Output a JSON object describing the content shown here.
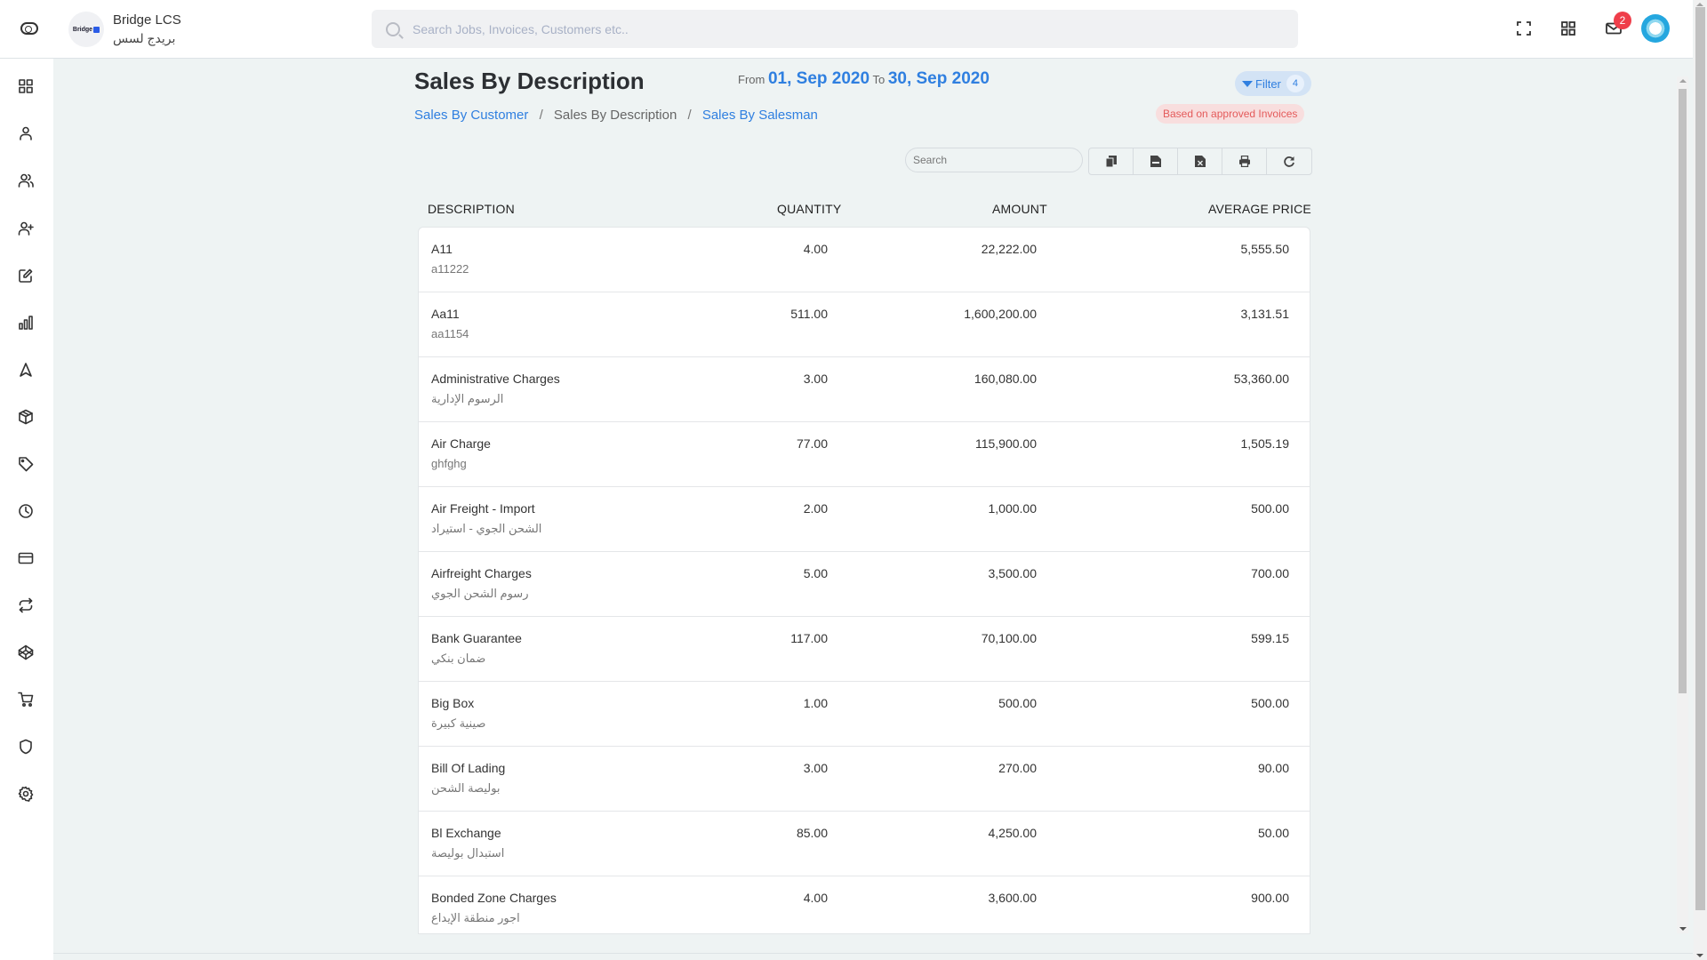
{
  "app": {
    "brand_name": "Bridge LCS",
    "brand_name_ar": "بريدج لسس",
    "logo_text": "Bridge"
  },
  "header": {
    "search_placeholder": "Search Jobs, Invoices, Customers etc..",
    "notification_count": "2",
    "icons": [
      "sidebar-toggle-icon",
      "fullscreen-icon",
      "apps-grid-icon",
      "mail-icon",
      "user-avatar"
    ]
  },
  "sidebar": {
    "items": [
      {
        "name": "dashboard",
        "icon": "grid-icon"
      },
      {
        "name": "user",
        "icon": "user-icon"
      },
      {
        "name": "users",
        "icon": "users-icon"
      },
      {
        "name": "add-user",
        "icon": "user-plus-icon"
      },
      {
        "name": "edit",
        "icon": "edit-icon"
      },
      {
        "name": "reports",
        "icon": "bar-chart-icon"
      },
      {
        "name": "navigation",
        "icon": "navigation-icon"
      },
      {
        "name": "packages",
        "icon": "box-icon"
      },
      {
        "name": "tags",
        "icon": "tag-icon"
      },
      {
        "name": "history",
        "icon": "clock-icon"
      },
      {
        "name": "payments",
        "icon": "credit-card-icon"
      },
      {
        "name": "transfers",
        "icon": "repeat-icon"
      },
      {
        "name": "codepen",
        "icon": "codepen-icon"
      },
      {
        "name": "cart",
        "icon": "shopping-cart-icon"
      },
      {
        "name": "security",
        "icon": "shield-icon"
      },
      {
        "name": "settings",
        "icon": "settings-icon"
      }
    ]
  },
  "page": {
    "title": "Sales By Description",
    "from_label": "From",
    "from_date": "01, Sep 2020",
    "to_label": "To",
    "to_date": "30, Sep 2020",
    "filter_label": "Filter",
    "filter_count": "4",
    "approved_badge": "Based on approved Invoices",
    "breadcrumb": {
      "link1": "Sales By Customer",
      "current": "Sales By Description",
      "link2": "Sales By Salesman",
      "separator": "/"
    },
    "table_search_placeholder": "Search",
    "tools": [
      "copy",
      "csv",
      "excel",
      "print",
      "refresh"
    ]
  },
  "table": {
    "columns": [
      "DESCRIPTION",
      "QUANTITY",
      "AMOUNT",
      "AVERAGE PRICE"
    ],
    "rows": [
      {
        "description": "A11",
        "sub": "a11222",
        "quantity": "4.00",
        "amount": "22,222.00",
        "average_price": "5,555.50"
      },
      {
        "description": "Aa11",
        "sub": "aa1154",
        "quantity": "511.00",
        "amount": "1,600,200.00",
        "average_price": "3,131.51"
      },
      {
        "description": "Administrative Charges",
        "sub": "الرسوم الإدارية",
        "quantity": "3.00",
        "amount": "160,080.00",
        "average_price": "53,360.00"
      },
      {
        "description": "Air Charge",
        "sub": "ghfghg",
        "quantity": "77.00",
        "amount": "115,900.00",
        "average_price": "1,505.19"
      },
      {
        "description": "Air Freight - Import",
        "sub": "الشحن الجوي - استيراد",
        "quantity": "2.00",
        "amount": "1,000.00",
        "average_price": "500.00"
      },
      {
        "description": "Airfreight Charges",
        "sub": "رسوم الشحن الجوي",
        "quantity": "5.00",
        "amount": "3,500.00",
        "average_price": "700.00"
      },
      {
        "description": "Bank Guarantee",
        "sub": "ضمان بنكي",
        "quantity": "117.00",
        "amount": "70,100.00",
        "average_price": "599.15"
      },
      {
        "description": "Big Box",
        "sub": "صينية كبيرة",
        "quantity": "1.00",
        "amount": "500.00",
        "average_price": "500.00"
      },
      {
        "description": "Bill Of Lading",
        "sub": "بوليصة الشحن",
        "quantity": "3.00",
        "amount": "270.00",
        "average_price": "90.00"
      },
      {
        "description": "Bl Exchange",
        "sub": "استبدال بوليصة",
        "quantity": "85.00",
        "amount": "4,250.00",
        "average_price": "50.00"
      },
      {
        "description": "Bonded Zone Charges",
        "sub": "اجور منطقة الإيداع",
        "quantity": "4.00",
        "amount": "3,600.00",
        "average_price": "900.00"
      }
    ]
  },
  "colors": {
    "accent": "#2f7fe0",
    "badge_red": "#ef3e4a",
    "approved_bg": "#f8dede",
    "approved_text": "#e45a5a",
    "background": "#eef3f3"
  }
}
